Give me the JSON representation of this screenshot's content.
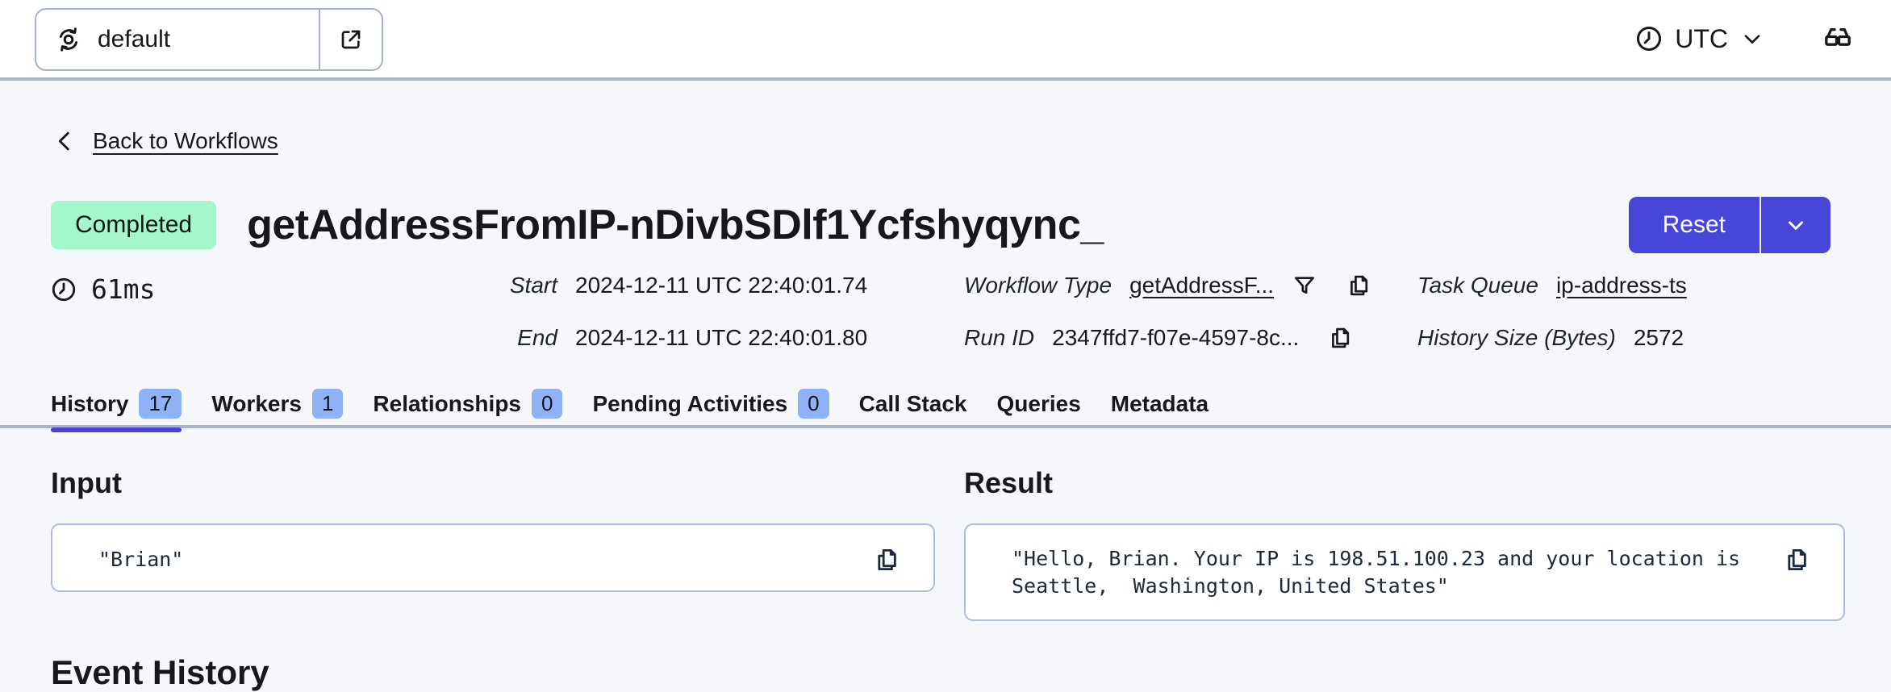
{
  "topbar": {
    "namespace": "default",
    "timezone": "UTC"
  },
  "nav": {
    "back_label": "Back to Workflows"
  },
  "workflow": {
    "status": "Completed",
    "id": "getAddressFromIP-nDivbSDlf1Ycfshyqync_",
    "duration": "61ms",
    "reset_label": "Reset",
    "details": {
      "start_label": "Start",
      "start_value": "2024-12-11 UTC 22:40:01.74",
      "end_label": "End",
      "end_value": "2024-12-11 UTC 22:40:01.80",
      "workflow_type_label": "Workflow Type",
      "workflow_type_value": "getAddressF...",
      "run_id_label": "Run ID",
      "run_id_value": "2347ffd7-f07e-4597-8c...",
      "task_queue_label": "Task Queue",
      "task_queue_value": "ip-address-ts",
      "history_size_label": "History Size (Bytes)",
      "history_size_value": "2572"
    }
  },
  "tabs": [
    {
      "label": "History",
      "badge": "17",
      "active": true
    },
    {
      "label": "Workers",
      "badge": "1"
    },
    {
      "label": "Relationships",
      "badge": "0"
    },
    {
      "label": "Pending Activities",
      "badge": "0"
    },
    {
      "label": "Call Stack"
    },
    {
      "label": "Queries"
    },
    {
      "label": "Metadata"
    }
  ],
  "io": {
    "input_title": "Input",
    "input_value": "\"Brian\"",
    "result_title": "Result",
    "result_value": "\"Hello, Brian. Your IP is 198.51.100.23 and your location is Seattle,  Washington, United States\""
  },
  "sections": {
    "event_history_title": "Event History"
  },
  "colors": {
    "accent_indigo": "#4845D9",
    "status_completed_bg": "#A4F6CC",
    "tab_badge_bg": "#8FB2F6",
    "divider": "#A9B4C9",
    "box_border": "#AFBEDB",
    "page_bg": "#F5F7FB",
    "mono_text": "#1D2A3A"
  }
}
